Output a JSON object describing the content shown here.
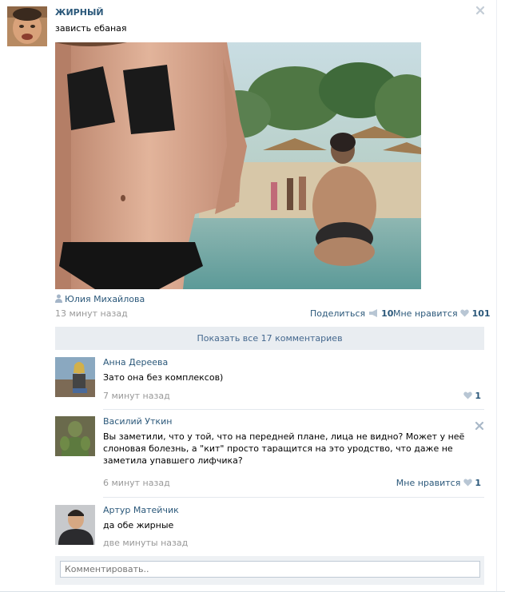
{
  "post": {
    "author": "ЖИРНЫЙ",
    "text": "зависть ебаная",
    "photo_author": "Юлия Михайлова",
    "time": "13 минут назад",
    "share_label": "Поделиться",
    "share_count": "10",
    "like_label": "Мне нравится",
    "like_count": "101",
    "show_all": "Показать все 17 комментариев"
  },
  "comments": [
    {
      "name": "Анна Дереева",
      "text": "Зато она без комплексов)",
      "time": "7 минут назад",
      "like_count": "1"
    },
    {
      "name": "Василий Уткин",
      "text": "Вы заметили, что у той, что на передней плане, лица не видно? Может у неё слоновая болезнь, а \"кит\" просто таращится на это уродство, что даже не заметила упавшего лифчика?",
      "time": "6 минут назад",
      "like_label": "Мне нравится",
      "like_count": "1"
    },
    {
      "name": "Артур Матейчик",
      "text": "да обе жирные",
      "time": "две минуты назад"
    }
  ],
  "reply": {
    "placeholder": "Комментировать.."
  },
  "colors": {
    "link": "#2b587a",
    "muted": "#999999",
    "show_all_bg": "#e9edf1"
  },
  "icons": {
    "close": "close-icon",
    "person": "person-icon",
    "share": "megaphone-icon",
    "like": "heart-icon"
  }
}
